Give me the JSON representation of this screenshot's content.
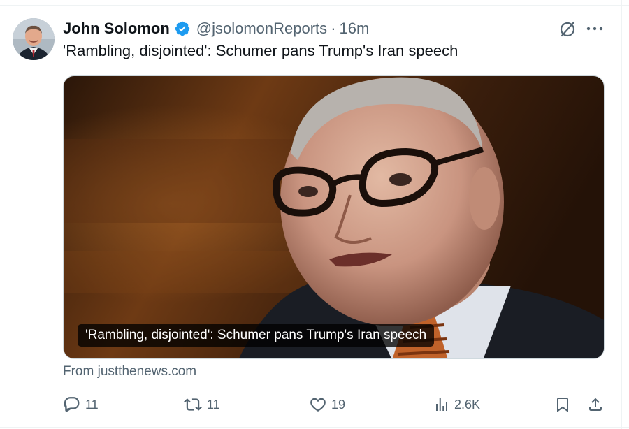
{
  "author": {
    "name": "John Solomon",
    "handle": "@jsolomonReports",
    "separator": "·",
    "time": "16m",
    "verified": true
  },
  "tweet": {
    "text": "'Rambling, disjointed': Schumer pans Trump's Iran speech"
  },
  "card": {
    "caption": "'Rambling, disjointed': Schumer pans Trump's Iran speech",
    "source": "From justthenews.com"
  },
  "actions": {
    "replies": "11",
    "retweets": "11",
    "likes": "19",
    "views": "2.6K"
  },
  "icons": {
    "verified": "verified-badge-icon",
    "grok": "grok-icon",
    "more": "more-icon",
    "reply": "reply-icon",
    "retweet": "retweet-icon",
    "like": "like-icon",
    "views": "views-icon",
    "bookmark": "bookmark-icon",
    "share": "share-icon"
  },
  "colors": {
    "text": "#0f1419",
    "secondary": "#536471",
    "verified": "#1d9bf0",
    "border": "#cfd9de"
  }
}
